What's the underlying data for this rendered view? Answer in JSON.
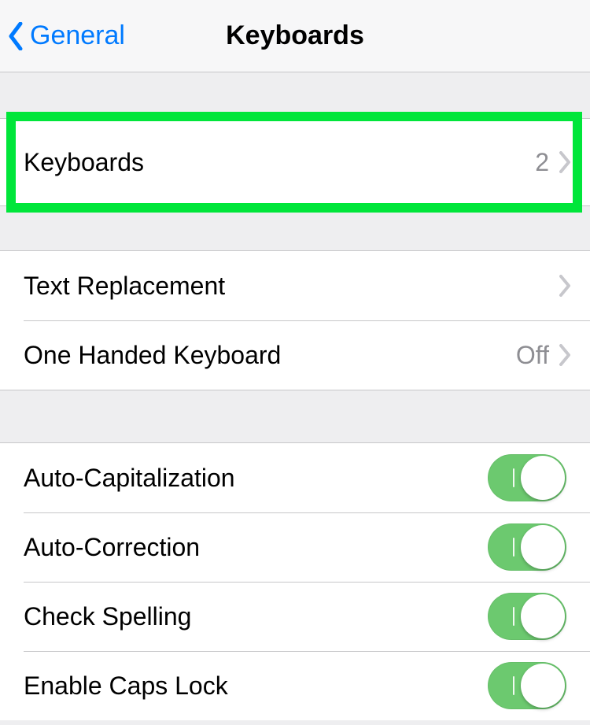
{
  "nav": {
    "back_label": "General",
    "title": "Keyboards"
  },
  "group1": {
    "keyboards_label": "Keyboards",
    "keyboards_count": "2"
  },
  "group2": {
    "text_replacement_label": "Text Replacement",
    "one_handed_label": "One Handed Keyboard",
    "one_handed_value": "Off"
  },
  "group3": {
    "auto_cap_label": "Auto-Capitalization",
    "auto_cap_on": true,
    "auto_corr_label": "Auto-Correction",
    "auto_corr_on": true,
    "check_spell_label": "Check Spelling",
    "check_spell_on": true,
    "caps_lock_label": "Enable Caps Lock",
    "caps_lock_on": true
  }
}
